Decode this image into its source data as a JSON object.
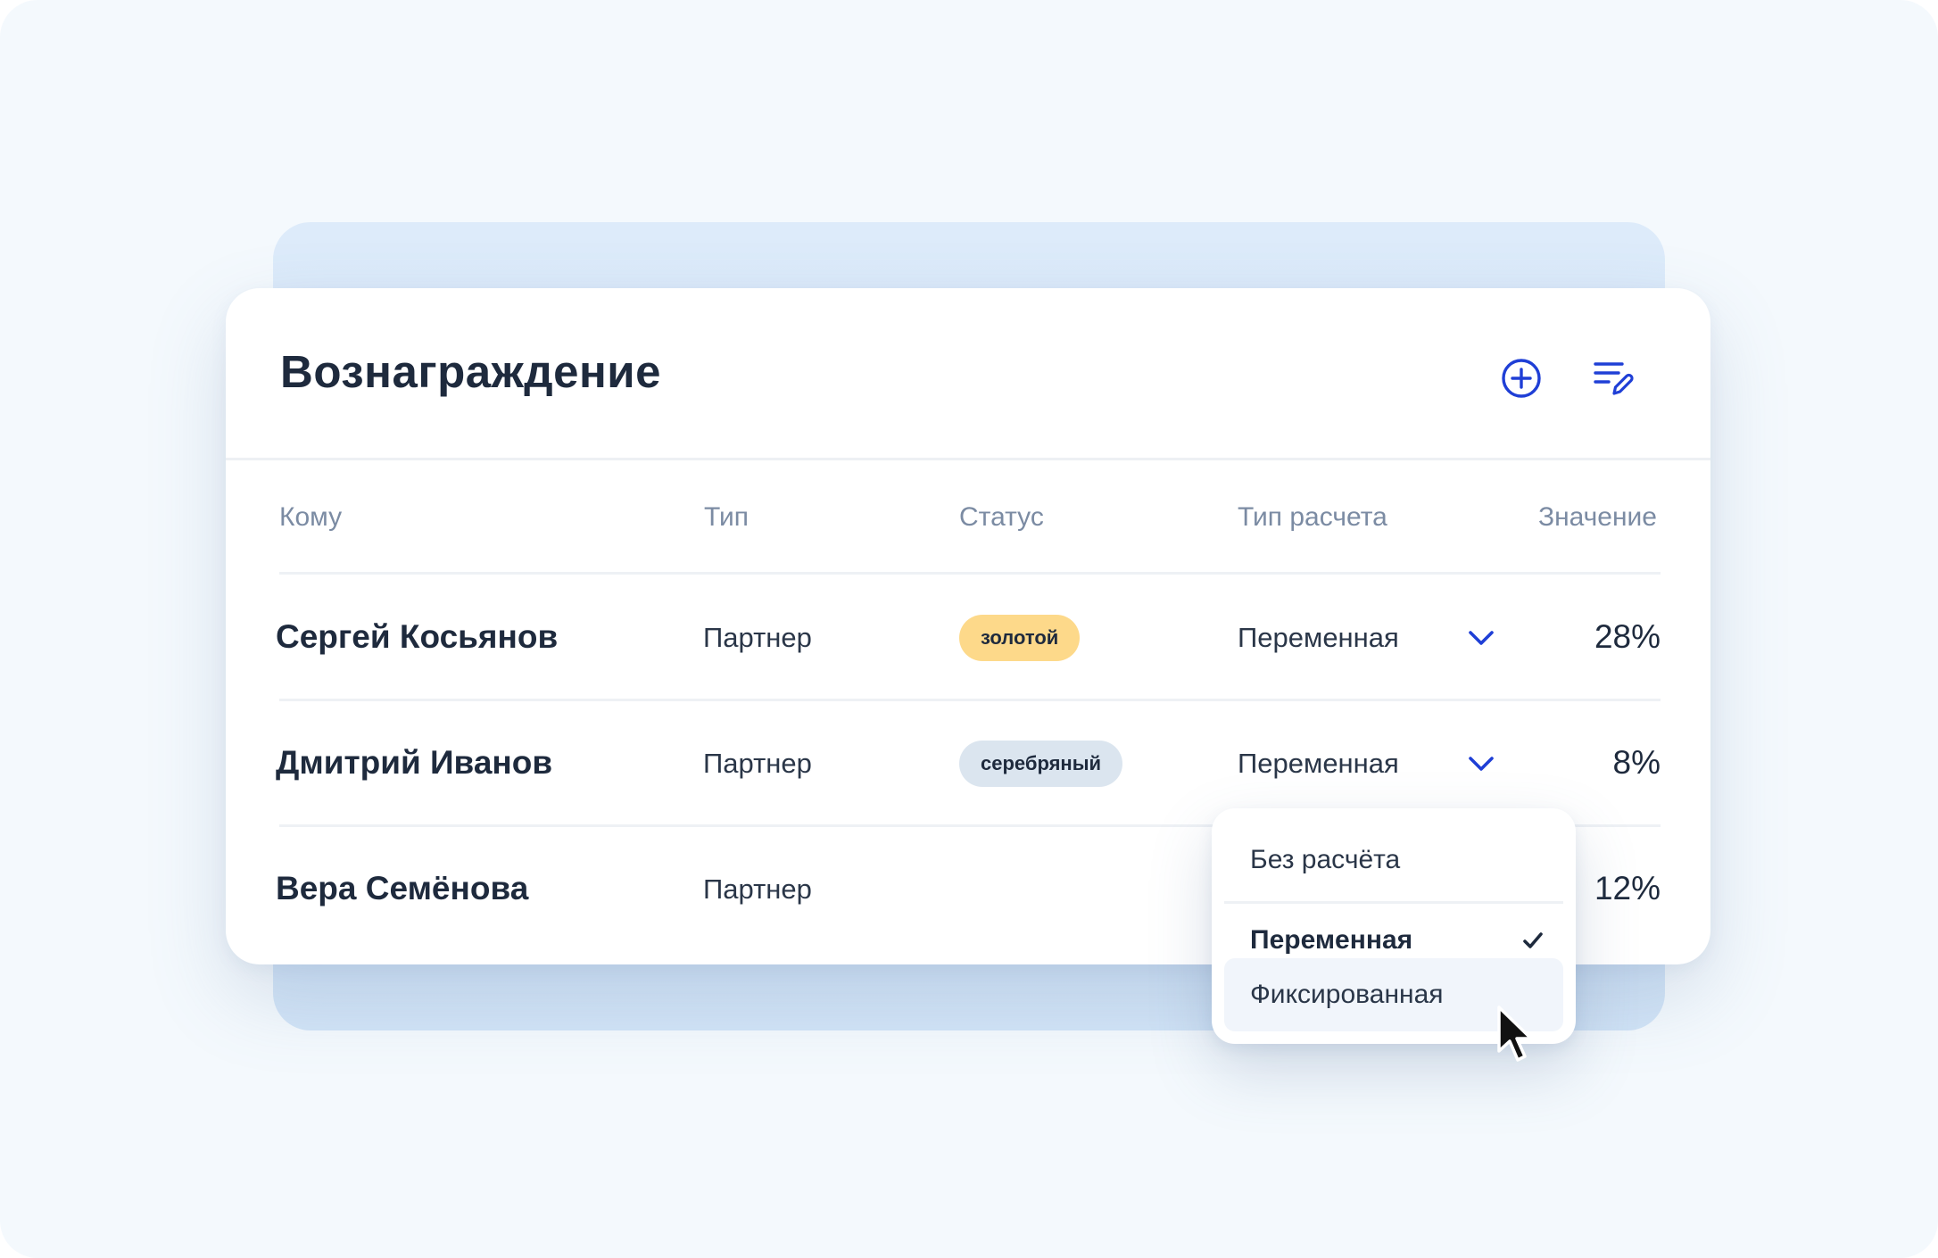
{
  "card": {
    "title": "Вознаграждение",
    "actions": {
      "add_icon": "plus-circle-icon",
      "edit_icon": "list-edit-icon"
    }
  },
  "table": {
    "headers": {
      "to_whom": "Кому",
      "type": "Тип",
      "status": "Статус",
      "calc_type": "Тип расчета",
      "value": "Значение"
    },
    "rows": [
      {
        "name": "Сергей Косьянов",
        "type": "Партнер",
        "status": "золотой",
        "calc_type": "Переменная",
        "value": "28%"
      },
      {
        "name": "Дмитрий Иванов",
        "type": "Партнер",
        "status": "серебряный",
        "calc_type": "Переменная",
        "value": "8%"
      },
      {
        "name": "Вера Семёнова",
        "type": "Партнер",
        "status": "",
        "calc_type": "",
        "value": "12%"
      }
    ]
  },
  "dropdown": {
    "options": [
      {
        "label": "Без расчёта"
      },
      {
        "label": "Переменная",
        "selected": true
      },
      {
        "label": "Фиксированная",
        "hovered": true
      }
    ]
  },
  "colors": {
    "accent": "#1f3fd6",
    "badge_gold": "#fdd98a",
    "badge_silver": "#dbe5ef",
    "back_panel": "#d8e8f8"
  }
}
